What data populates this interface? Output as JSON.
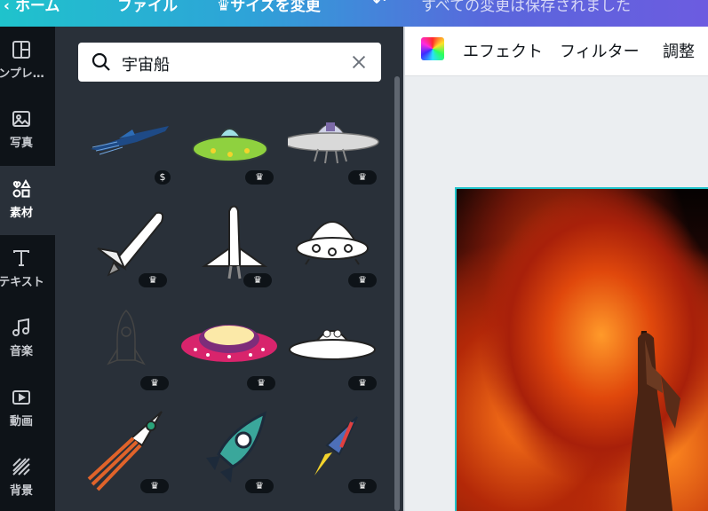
{
  "topbar": {
    "back_label": "ホーム",
    "file_label": "ファイル",
    "resize_label": "サイズを変更",
    "undo_icon": "undo-icon",
    "saved_status": "すべての変更は保存されました"
  },
  "rail": {
    "items": [
      {
        "label": "テンプレート",
        "icon": "layout-icon"
      },
      {
        "label": "写真",
        "icon": "photo-icon"
      },
      {
        "label": "素材",
        "icon": "elements-icon"
      },
      {
        "label": "テキスト",
        "icon": "text-icon"
      },
      {
        "label": "音楽",
        "icon": "music-icon"
      },
      {
        "label": "動画",
        "icon": "video-icon"
      },
      {
        "label": "背景",
        "icon": "background-icon"
      }
    ],
    "truncated_first_label": "ンプレ…",
    "active_index": 2
  },
  "search": {
    "value": "宇宙船",
    "search_icon": "search-icon",
    "clear_icon": "close-icon"
  },
  "results": [
    {
      "name": "blue-jet-spaceship",
      "badge": "$"
    },
    {
      "name": "green-ufo",
      "badge": "crown"
    },
    {
      "name": "silver-ufo-with-alien",
      "badge": "crown"
    },
    {
      "name": "space-shuttle-tilted",
      "badge": "crown"
    },
    {
      "name": "space-shuttle-upright",
      "badge": "crown"
    },
    {
      "name": "white-ufo-outline",
      "badge": "crown"
    },
    {
      "name": "rocket-outline",
      "badge": "crown"
    },
    {
      "name": "pink-ufo",
      "badge": "crown"
    },
    {
      "name": "alien-ufo-outline",
      "badge": "crown"
    },
    {
      "name": "orange-rocket",
      "badge": "crown"
    },
    {
      "name": "teal-rocket",
      "badge": "crown"
    },
    {
      "name": "red-blue-rocket",
      "badge": "crown"
    }
  ],
  "editor": {
    "toolbar": {
      "color_icon": "color-picker-icon",
      "effects_label": "エフェクト",
      "filter_label": "フィルター",
      "adjust_label": "調整"
    },
    "canvas_image": "fire-with-statue-of-liberty",
    "accent_color": "#20c4cb"
  }
}
